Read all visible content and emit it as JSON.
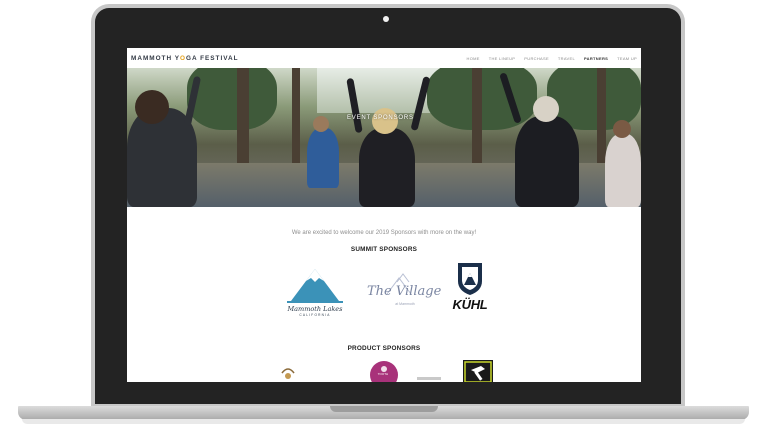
{
  "site": {
    "brand_part1": "MAMMOTH Y",
    "brand_accent": "O",
    "brand_part2": "GA FESTIVAL",
    "accent_color": "#e6a21b"
  },
  "nav": {
    "items": [
      {
        "label": "HOME"
      },
      {
        "label": "THE LINEUP"
      },
      {
        "label": "PURCHASE"
      },
      {
        "label": "TRAVEL"
      },
      {
        "label": "PARTNERS"
      },
      {
        "label": "TEAM UP"
      }
    ],
    "active_index": 4
  },
  "hero": {
    "caption": "EVENT SPONSORS"
  },
  "content": {
    "welcome": "We are excited to welcome our 2019 Sponsors with more on the way!",
    "summit_title": "SUMMIT SPONSORS",
    "product_title": "PRODUCT SPONSORS"
  },
  "logos": {
    "mammoth_name": "Mammoth Lakes",
    "mammoth_sub": "CALIFORNIA",
    "village_name": "The Village",
    "village_sub": "at Mammoth",
    "kuhl_name": "KÜHL",
    "tooth_text": "TOOTH"
  }
}
